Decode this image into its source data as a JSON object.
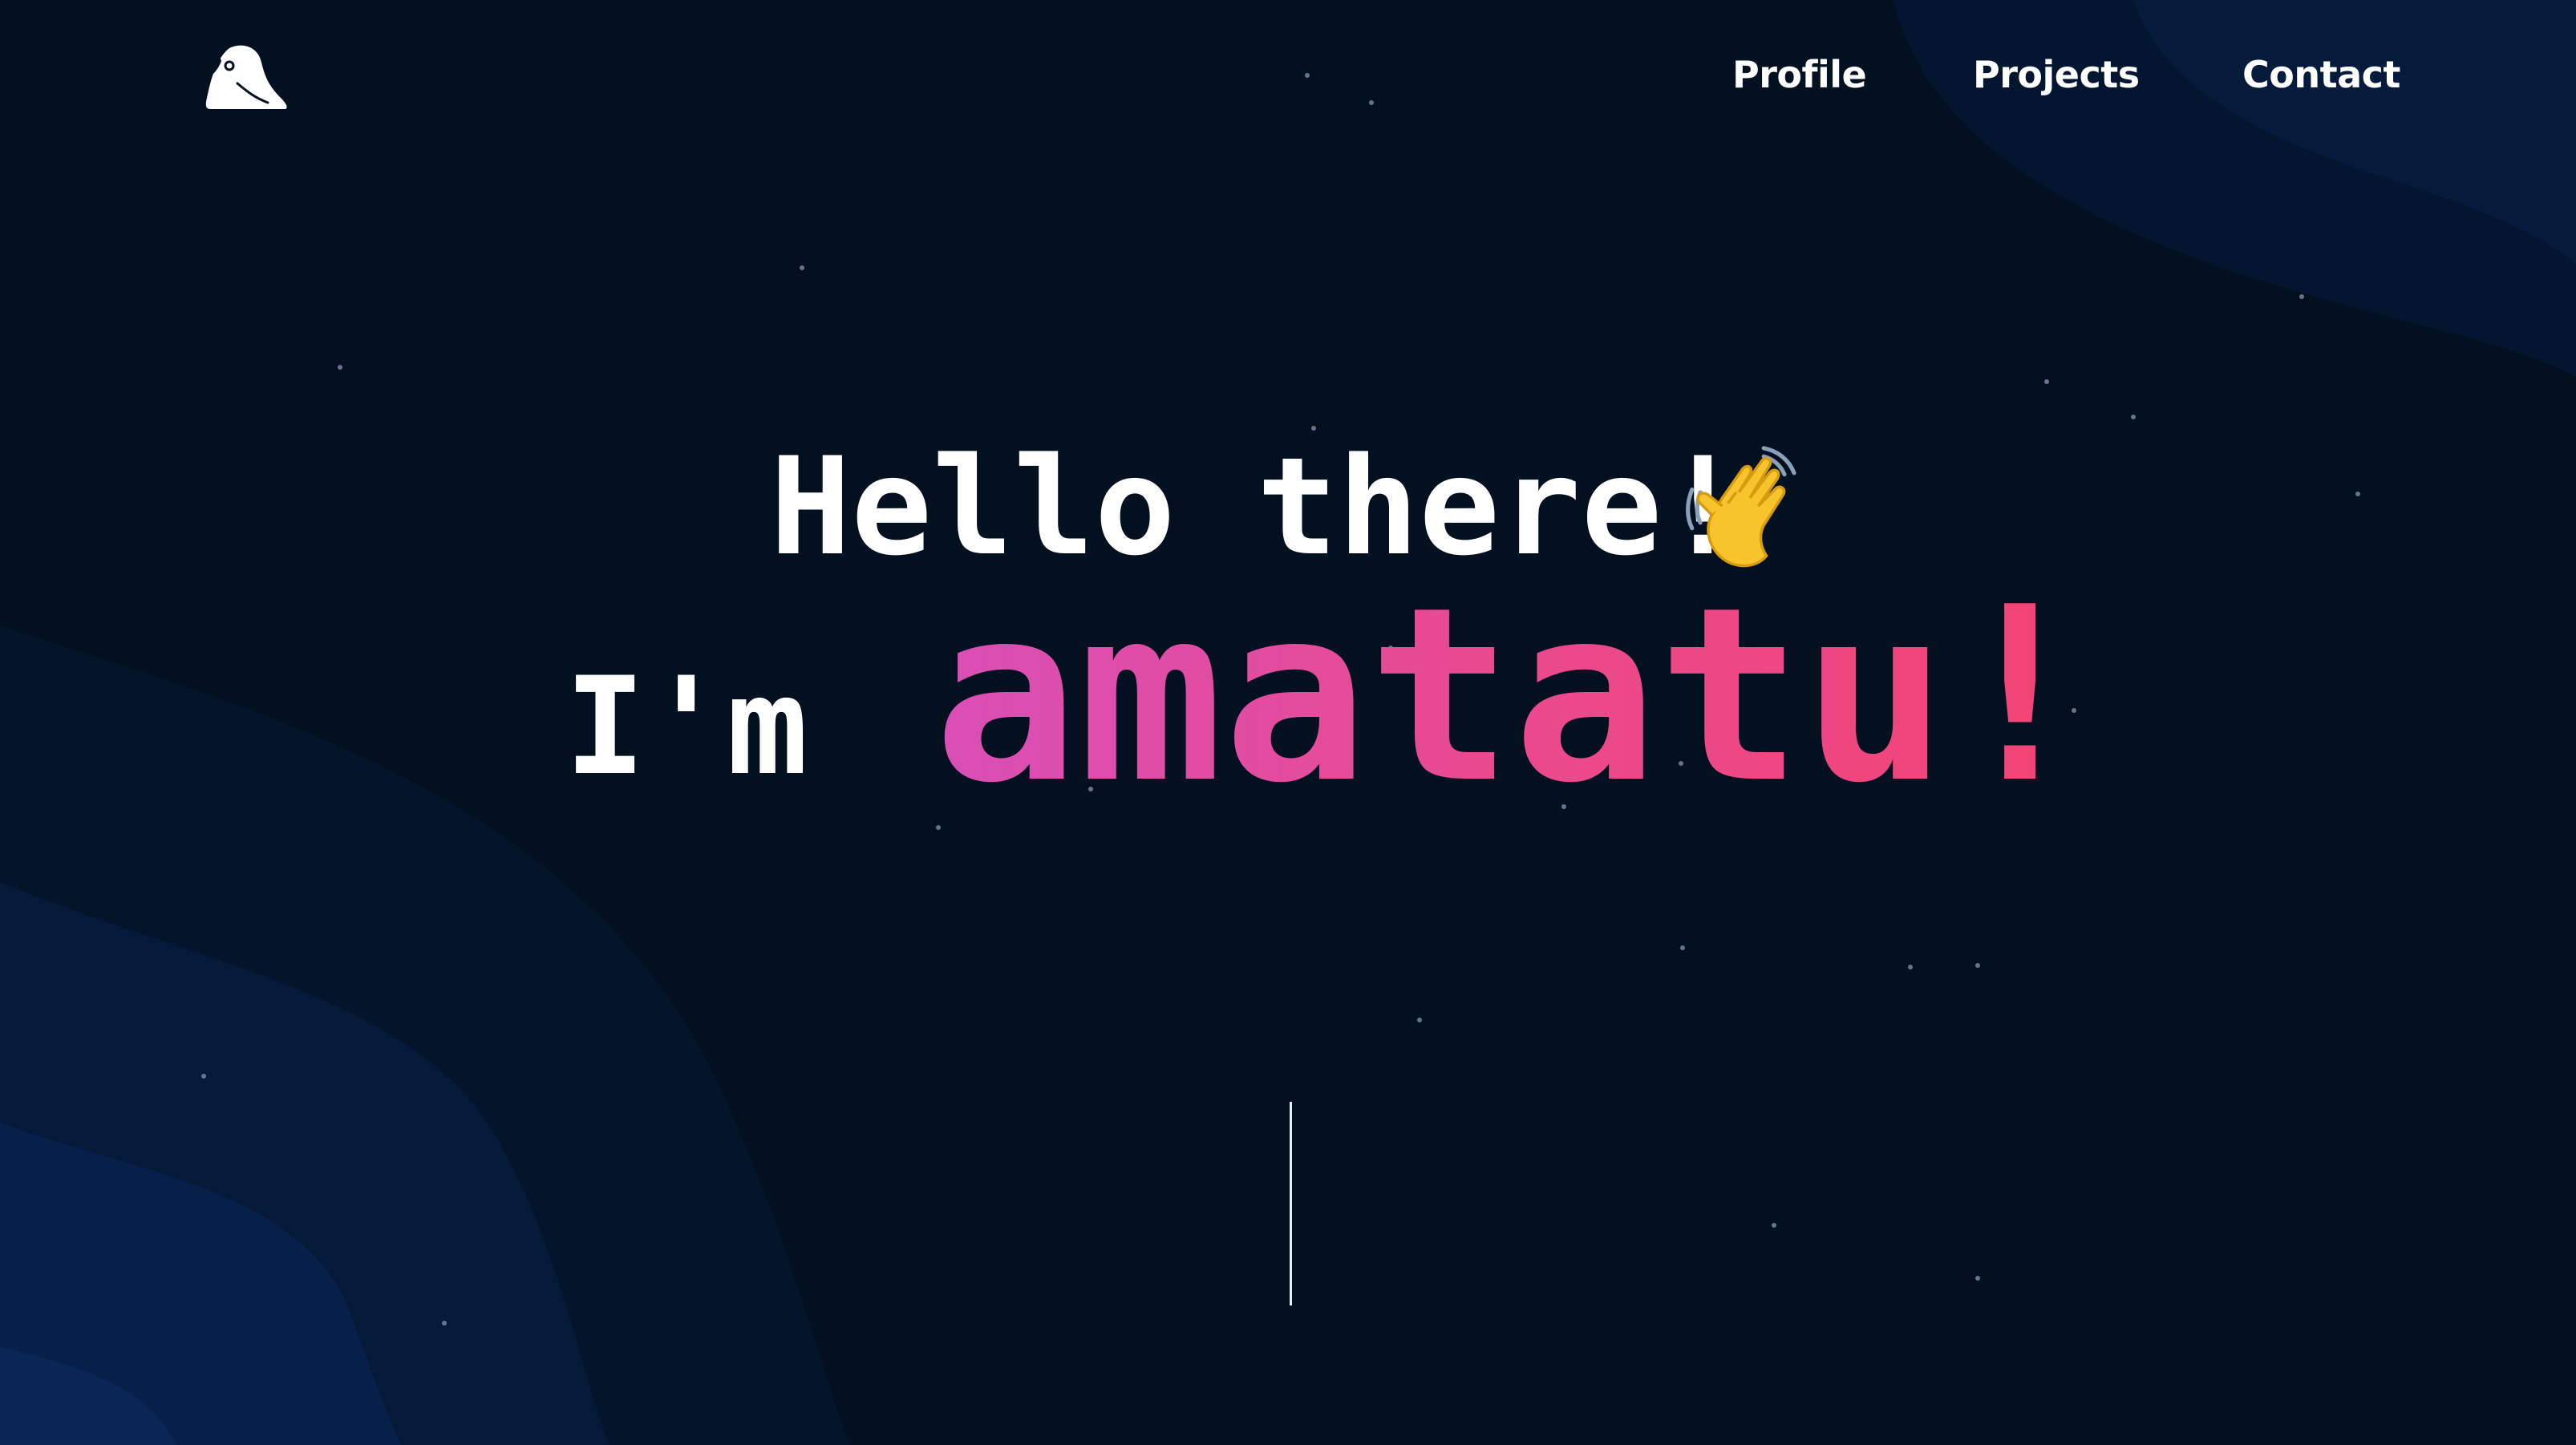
{
  "nav": {
    "items": [
      {
        "label": "Profile"
      },
      {
        "label": "Projects"
      },
      {
        "label": "Contact"
      }
    ]
  },
  "hero": {
    "greeting": "Hello there!",
    "greeting_emoji_icon": "waving-hand-icon",
    "intro_prefix": "I'm",
    "name": "amatatu!"
  },
  "logo": {
    "icon": "parrot-logo-icon"
  },
  "colors": {
    "background": "#02101f",
    "wave_shape": "#061a38",
    "name_gradient_start": "#d94fb6",
    "name_gradient_end": "#f24374",
    "text": "#ffffff"
  }
}
